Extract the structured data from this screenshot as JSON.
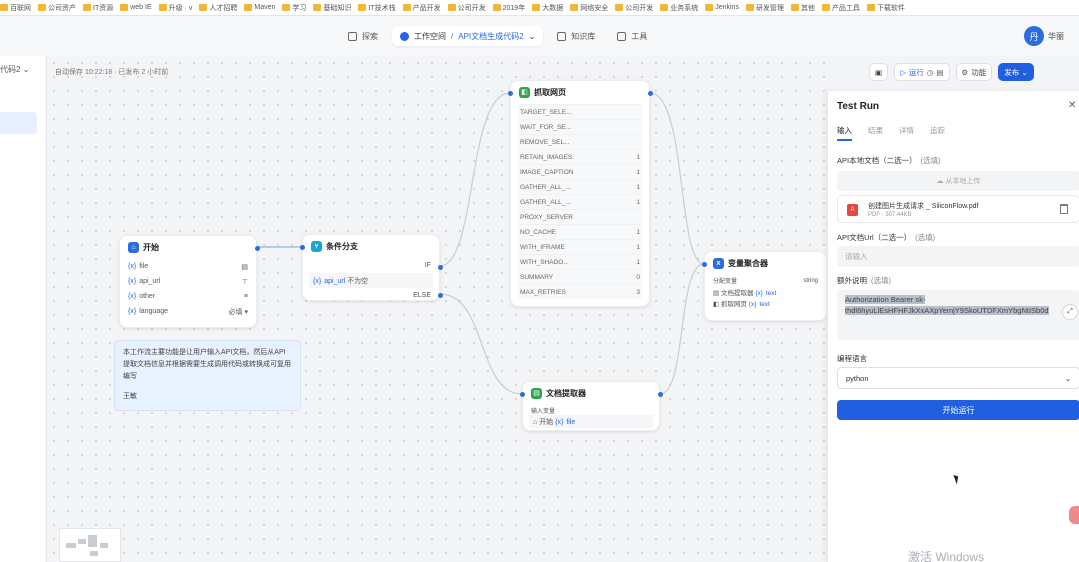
{
  "bookmarks": [
    {
      "label": "百联网"
    },
    {
      "label": "公司资产"
    },
    {
      "label": "IT资源"
    },
    {
      "label": "web IE"
    },
    {
      "label": "升级 · v"
    },
    {
      "label": "人才招聘"
    },
    {
      "label": "Maven"
    },
    {
      "label": "学习"
    },
    {
      "label": "基础知识"
    },
    {
      "label": "IT技术栈"
    },
    {
      "label": "产品开发"
    },
    {
      "label": "公司开发"
    },
    {
      "label": "2019年"
    },
    {
      "label": "大数据"
    },
    {
      "label": "网络安全"
    },
    {
      "label": "公司开发"
    },
    {
      "label": "业务系统"
    },
    {
      "label": "Jenkins"
    },
    {
      "label": "研发管理"
    },
    {
      "label": "其他"
    },
    {
      "label": "产品工具"
    },
    {
      "label": "下载软件"
    }
  ],
  "topbar": {
    "tabs": [
      {
        "label": "探索",
        "active": false
      },
      {
        "label": "工作空间",
        "sep": "/",
        "current": "API文档生成代码2",
        "active": true
      },
      {
        "label": "知识库",
        "active": false
      },
      {
        "label": "工具",
        "active": false
      }
    ],
    "user_initial": "丹",
    "user_name": "华丽"
  },
  "leftbar": {
    "workflow_name": "代码2"
  },
  "canvas": {
    "autosave": "自动保存 10:22:18 · 已发布 2 小时前",
    "toolbar": {
      "run_label": "运行",
      "features_label": "功能",
      "publish_label": "发布"
    },
    "nodes": {
      "start": {
        "title": "开始",
        "vars": [
          {
            "name": "file",
            "icon": "file"
          },
          {
            "name": "api_url",
            "icon": "text"
          },
          {
            "name": "other",
            "icon": "paragraph"
          },
          {
            "name": "language",
            "required": "必填"
          }
        ]
      },
      "condition": {
        "title": "条件分支",
        "if_label": "IF",
        "else_label": "ELSE",
        "cond_var": "api_url",
        "cond_op": "不为空"
      },
      "scrape": {
        "title": "抓取网页",
        "params": [
          {
            "name": "TARGET_SELE...",
            "val": ""
          },
          {
            "name": "WAIT_FOR_SE...",
            "val": ""
          },
          {
            "name": "REMOVE_SEL...",
            "val": ""
          },
          {
            "name": "RETAIN_IMAGES",
            "val": "1"
          },
          {
            "name": "IMAGE_CAPTION",
            "val": "1"
          },
          {
            "name": "GATHER_ALL_...",
            "val": "1"
          },
          {
            "name": "GATHER_ALL_...",
            "val": "1"
          },
          {
            "name": "PROXY_SERVER",
            "val": ""
          },
          {
            "name": "NO_CACHE",
            "val": "1"
          },
          {
            "name": "WITH_IFRAME",
            "val": "1"
          },
          {
            "name": "WITH_SHADO...",
            "val": "1"
          },
          {
            "name": "SUMMARY",
            "val": "0"
          },
          {
            "name": "MAX_RETRIES",
            "val": "3"
          }
        ]
      },
      "aggregator": {
        "title": "变量聚合器",
        "sub": "分配变量",
        "string": "string",
        "rows": [
          {
            "name": "文档提取器",
            "val": "text"
          },
          {
            "name": "抓取网页",
            "val": "text"
          }
        ]
      },
      "extractor": {
        "title": "文档提取器",
        "sub": "输入变量",
        "input_name": "开始",
        "input_var": "file"
      }
    },
    "note": {
      "text": "本工作流主要功能是让用户输入API文档，然后从API提取文档信息并根据需要生成调用代码或转换成可复用编写",
      "author": "王敏"
    }
  },
  "panel": {
    "title": "Test Run",
    "tabs": [
      "输入",
      "结果",
      "详情",
      "追踪"
    ],
    "active_tab": 0,
    "api_doc_label": "API本地文档（二选一）",
    "api_doc_opt": "(选填)",
    "upload_label": "从本地上传",
    "file_name": "创建图片生成请求 _ SiliconFlow.pdf",
    "file_meta": "PDF · 307.44KB",
    "api_url_label": "API文档Url（二选一）",
    "api_url_opt": "(选填)",
    "api_url_placeholder": "请输入",
    "other_label": "额外说明",
    "other_opt": "(选填)",
    "other_value_line1": "Authorization Bearer sk-",
    "other_value_line2": "thdl6hyuLlEsHFHFJkXxAXpYemjY9SkoUTDFXmYbgNtISb0d",
    "lang_label": "编程语言",
    "lang_value": "python",
    "start_button": "开始运行"
  },
  "watermark": "激活 Windows",
  "colors": {
    "accent": "#1f5fe0",
    "start_icon": "#2c6be0",
    "condition_icon": "#16a5d4",
    "scrape_icon": "#2ea44f",
    "aggregator_icon": "#2c6be0",
    "extractor_icon": "#2ea44f",
    "note_bg": "#e8f1ff"
  }
}
